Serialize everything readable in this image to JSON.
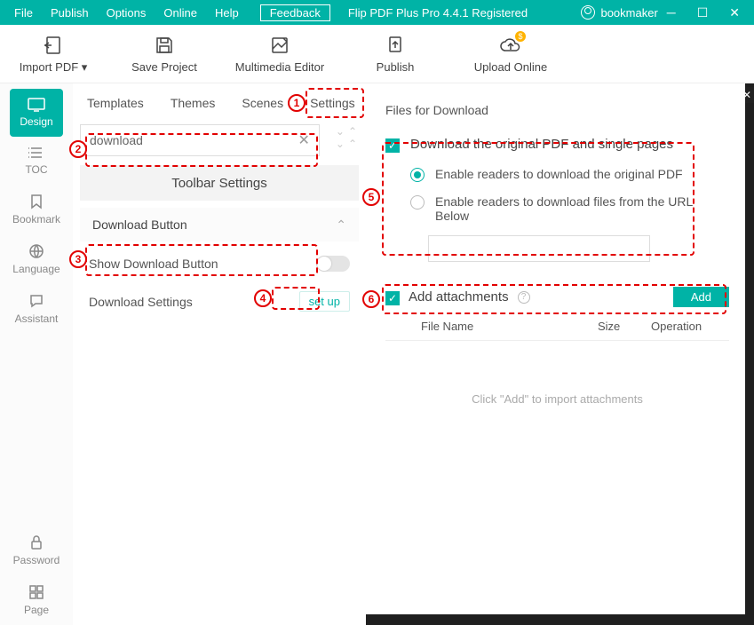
{
  "titlebar": {
    "menu": [
      "File",
      "Publish",
      "Options",
      "Online",
      "Help"
    ],
    "feedback": "Feedback",
    "app_title": "Flip PDF Plus Pro 4.4.1 Registered",
    "user": "bookmaker"
  },
  "toolbar": {
    "import_pdf": "Import PDF ▾",
    "save_project": "Save Project",
    "multimedia_editor": "Multimedia Editor",
    "publish": "Publish",
    "upload_online": "Upload Online"
  },
  "leftrail": {
    "design": "Design",
    "toc": "TOC",
    "bookmark": "Bookmark",
    "language": "Language",
    "assistant": "Assistant",
    "password": "Password",
    "page": "Page"
  },
  "tabs": {
    "templates": "Templates",
    "themes": "Themes",
    "scenes": "Scenes",
    "settings": "Settings"
  },
  "search": {
    "value": "download"
  },
  "toolbar_settings_header": "Toolbar Settings",
  "download_button_accordion": "Download Button",
  "show_download_button": "Show Download Button",
  "download_settings_label": "Download Settings",
  "set_up": "set up",
  "dialog": {
    "title": "Files for Download",
    "chk1": "Download the original PDF and single pages",
    "radio1": "Enable readers to download the original PDF",
    "radio2": "Enable readers to download files from the URL Below",
    "chk2": "Add attachments",
    "add_btn": "Add",
    "col_filename": "File Name",
    "col_size": "Size",
    "col_operation": "Operation",
    "empty": "Click \"Add\" to import attachments"
  },
  "annotations": [
    "1",
    "2",
    "3",
    "4",
    "5",
    "6"
  ]
}
